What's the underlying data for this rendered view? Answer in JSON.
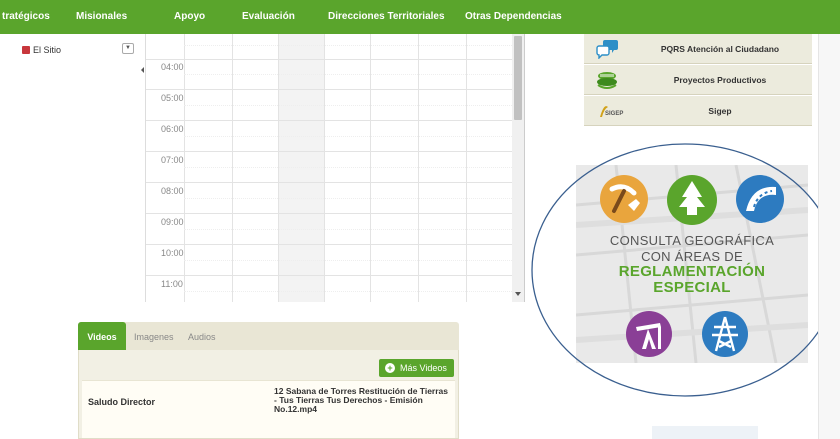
{
  "nav": {
    "items": [
      "tratégicos",
      "Misionales",
      "Apoyo",
      "Evaluación",
      "Direcciones Territoriales",
      "Otras Dependencias"
    ],
    "bg_color": "#5aa52c"
  },
  "filter": {
    "label": "El Sitio",
    "swatch_color": "#c8373c",
    "dropdown_icon": "chevron-down-icon"
  },
  "calendar": {
    "times": [
      "04:00",
      "05:00",
      "06:00",
      "07:00",
      "08:00",
      "09:00",
      "10:00",
      "11:00"
    ]
  },
  "right_links": [
    {
      "label": "PQRS Atención al Ciudadano",
      "icon": "chat-bubbles-icon"
    },
    {
      "label": "Proyectos Productivos",
      "icon": "productive-projects-icon"
    },
    {
      "label": "Sigep",
      "icon": "sigep-logo-icon"
    }
  ],
  "geo_banner": {
    "line1": "CONSULTA GEOGRÁFICA",
    "line2": "CON ÁREAS DE",
    "line3": "REGLAMENTACIÓN",
    "line4": "ESPECIAL",
    "accent_color": "#5aa52c",
    "icons": [
      "mining-icon",
      "forest-icon",
      "road-icon",
      "oil-pump-icon",
      "power-tower-icon"
    ]
  },
  "media": {
    "tabs": [
      "Videos",
      "Imagenes",
      "Audios"
    ],
    "more_label": "Más Videos",
    "items": [
      {
        "title": "Saludo Director",
        "file": "12 Sabana de Torres Restitución de Tierras - Tus Tierras Tus Derechos - Emisión No.12.mp4"
      }
    ]
  }
}
